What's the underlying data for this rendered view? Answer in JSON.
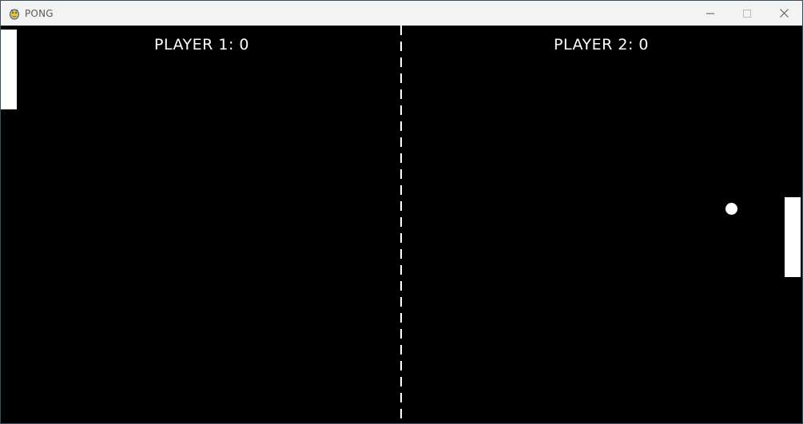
{
  "window": {
    "title": "PONG",
    "app_icon": "pygame-snake-icon",
    "controls": {
      "minimize_icon": "minimize-icon",
      "maximize_icon": "maximize-icon",
      "close_icon": "close-icon"
    }
  },
  "game": {
    "player1_score_label": "PLAYER 1: 0",
    "player2_score_label": "PLAYER 2: 0",
    "colors": {
      "background": "#000000",
      "foreground": "#ffffff"
    }
  }
}
